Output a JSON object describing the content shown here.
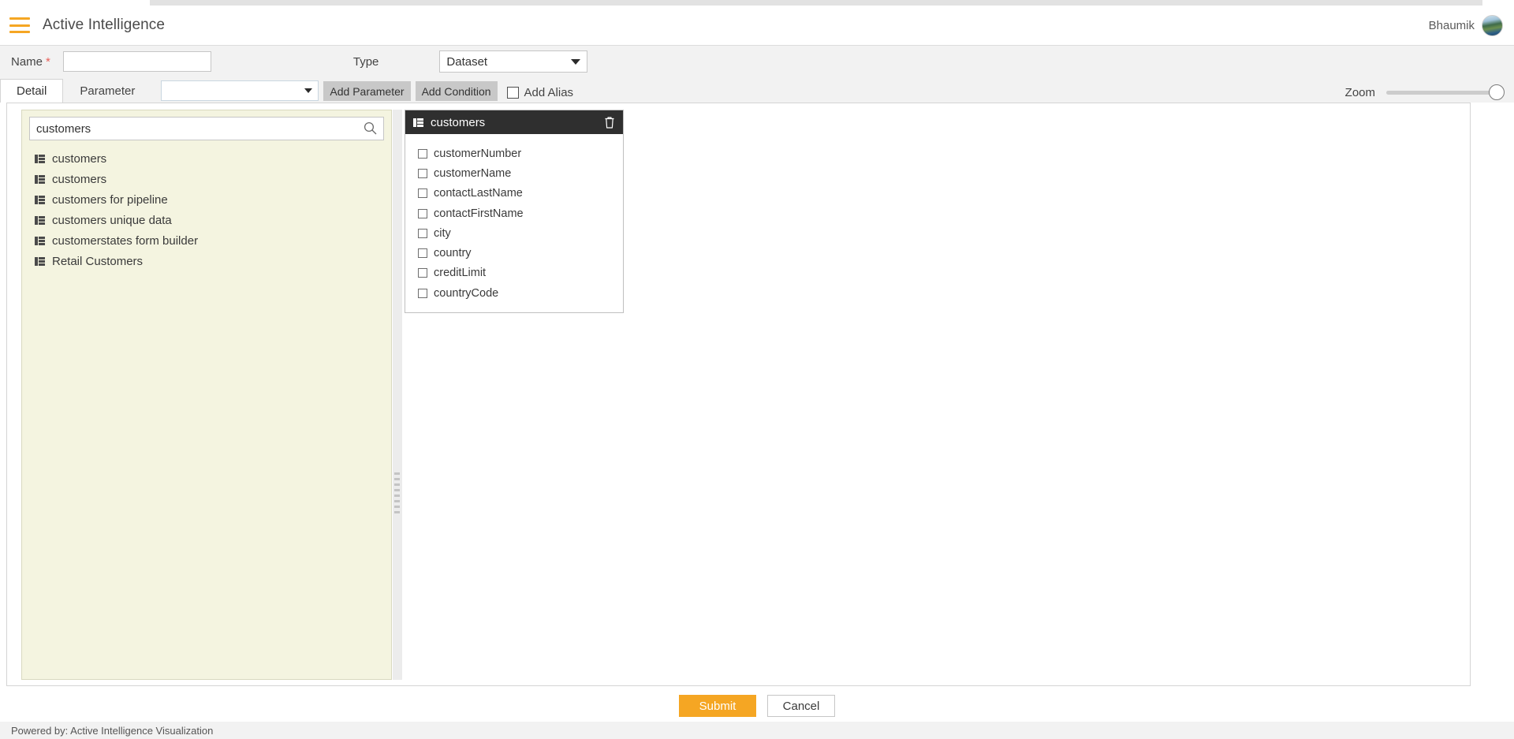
{
  "header": {
    "menu_icon": "hamburger-icon",
    "title": "Active Intelligence",
    "user_name": "Bhaumik",
    "avatar_icon": "avatar-image"
  },
  "form": {
    "name_label": "Name",
    "required_mark": "*",
    "name_value": "",
    "name_placeholder": "",
    "type_label": "Type",
    "type_value": "Dataset",
    "type_options": [
      "Dataset"
    ]
  },
  "toolbar": {
    "tabs": [
      {
        "label": "Detail",
        "active": true
      },
      {
        "label": "Parameter",
        "active": false
      }
    ],
    "parameter_select_value": "",
    "add_parameter_label": "Add Parameter",
    "add_condition_label": "Add Condition",
    "add_alias_label": "Add Alias",
    "add_alias_checked": false,
    "zoom_label": "Zoom",
    "zoom_value": 100
  },
  "left_pane": {
    "search_value": "customers",
    "search_placeholder": "",
    "search_icon": "search-icon",
    "results": [
      {
        "label": "customers",
        "icon": "table-icon"
      },
      {
        "label": "customers",
        "icon": "table-icon"
      },
      {
        "label": "customers for pipeline",
        "icon": "table-icon"
      },
      {
        "label": "customers unique data",
        "icon": "table-icon"
      },
      {
        "label": "customerstates form builder",
        "icon": "table-icon"
      },
      {
        "label": "Retail Customers",
        "icon": "table-icon"
      }
    ]
  },
  "canvas": {
    "table_card": {
      "title": "customers",
      "title_icon": "table-icon",
      "delete_icon": "trash-icon",
      "fields": [
        {
          "label": "customerNumber",
          "checked": false
        },
        {
          "label": "customerName",
          "checked": false
        },
        {
          "label": "contactLastName",
          "checked": false
        },
        {
          "label": "contactFirstName",
          "checked": false
        },
        {
          "label": "city",
          "checked": false
        },
        {
          "label": "country",
          "checked": false
        },
        {
          "label": "creditLimit",
          "checked": false
        },
        {
          "label": "countryCode",
          "checked": false
        }
      ]
    }
  },
  "actions": {
    "submit_label": "Submit",
    "cancel_label": "Cancel"
  },
  "footer": {
    "text": "Powered by: Active Intelligence Visualization"
  },
  "colors": {
    "accent_orange": "#f5a623",
    "panel_yellow": "#f4f4e0",
    "card_header_dark": "#2f2f2f",
    "required_red": "#e8605a"
  }
}
